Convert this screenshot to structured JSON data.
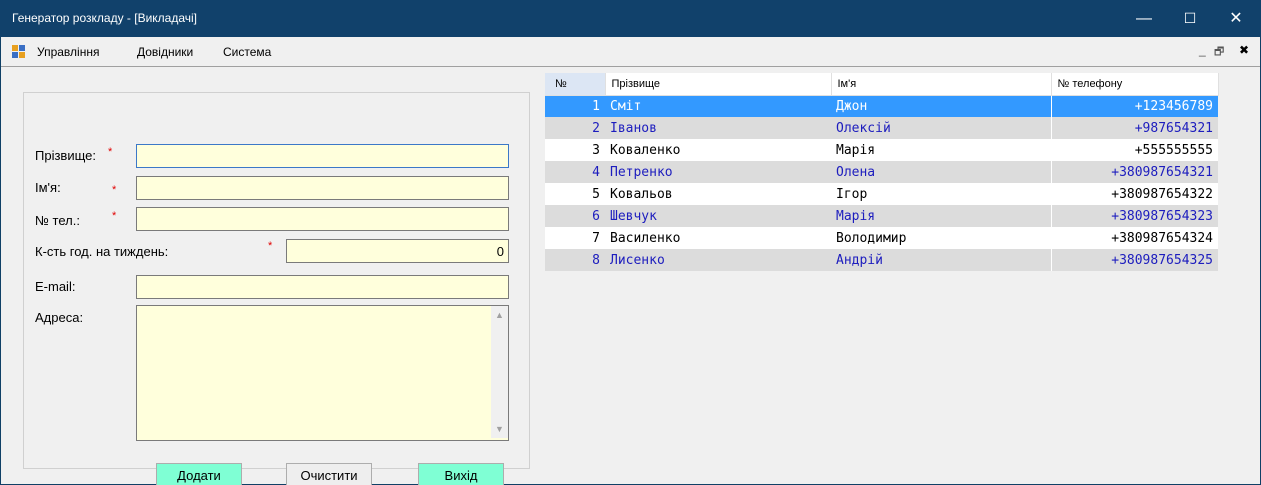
{
  "window": {
    "title": "Генератор розкладу - [Викладачі]",
    "minimize_glyph": "—",
    "maximize_glyph": "☐",
    "close_glyph": "✕"
  },
  "menu": {
    "items": [
      "Управління",
      "Довідники",
      "Система"
    ],
    "mdi_minimize": "_",
    "mdi_restore": "🗗",
    "mdi_close": "✖"
  },
  "form": {
    "surname_label": "Прізвище:",
    "name_label": "Ім'я:",
    "phone_label": "№ тел.:",
    "hours_label": "К-сть год. на тиждень:",
    "email_label": "E-mail:",
    "address_label": "Адреса:",
    "required_mark": "*",
    "surname_value": "",
    "name_value": "",
    "phone_value": "",
    "hours_value": "0",
    "email_value": "",
    "address_value": "",
    "add_button": "Додати",
    "clear_button": "Очистити",
    "exit_button": "Вихід"
  },
  "table": {
    "headers": [
      "№",
      "Прізвище",
      "Ім'я",
      "№ телефону"
    ],
    "rows": [
      [
        "1",
        "Сміт",
        "Джон",
        "+123456789"
      ],
      [
        "2",
        "Іванов",
        "Олексій",
        "+987654321"
      ],
      [
        "3",
        "Коваленко",
        "Марія",
        "+555555555"
      ],
      [
        "4",
        "Петренко",
        "Олена",
        "+380987654321"
      ],
      [
        "5",
        "Ковальов",
        "Ігор",
        "+380987654322"
      ],
      [
        "6",
        "Шевчук",
        "Марія",
        "+380987654323"
      ],
      [
        "7",
        "Василенко",
        "Володимир",
        "+380987654324"
      ],
      [
        "8",
        "Лисенко",
        "Андрій",
        "+380987654325"
      ]
    ],
    "selected_row": 1
  },
  "colors": {
    "titlebar": "#11416b",
    "field_bg": "#ffffdc",
    "button_bg": "#7fffd4",
    "selected_row": "#3399ff",
    "alt_row_text": "#1d1dbe",
    "required": "#e00000"
  }
}
